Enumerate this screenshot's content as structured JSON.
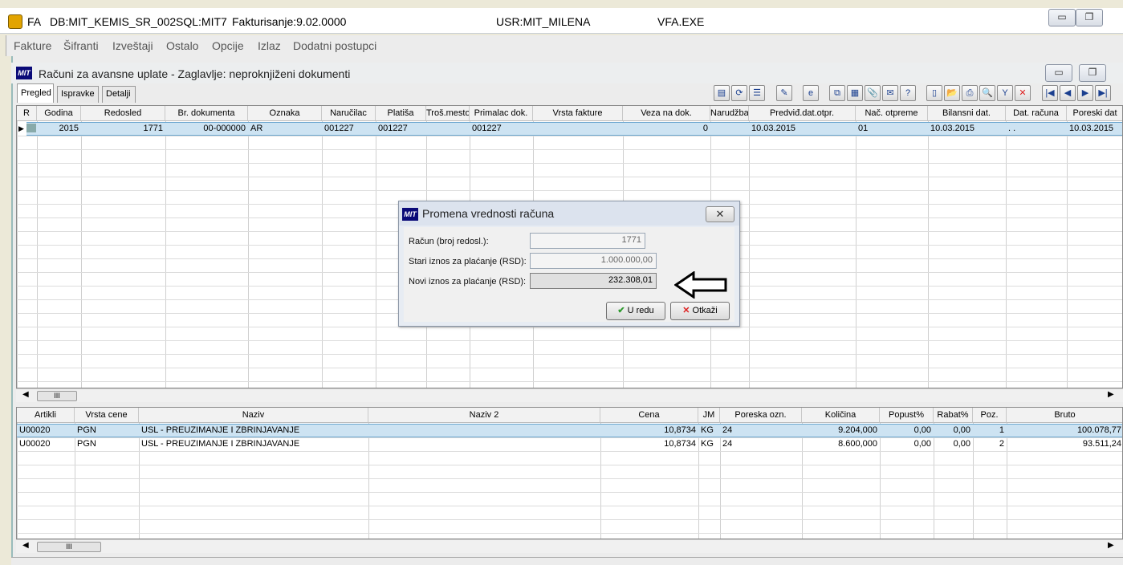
{
  "titlebar": {
    "app": "FA",
    "db": "DB:MIT_KEMIS_SR_002",
    "sql": "SQL:MIT7",
    "version": "Fakturisanje:9.02.0000",
    "user": "USR:MIT_MILENA",
    "exe": "VFA.EXE",
    "minimize": "▭",
    "restore": "❐"
  },
  "menu": [
    "Fakture",
    "Šifranti",
    "Izveštaji",
    "Ostalo",
    "Opcije",
    "Izlaz",
    "Dodatni postupci"
  ],
  "child": {
    "logo": "MIT",
    "title": "Računi za avansne uplate - Zaglavlje: neproknjiženi dokumenti",
    "tabs": [
      "Pregled",
      "Ispravke",
      "Detalji"
    ]
  },
  "toolbar_icons": [
    "form-icon",
    "refresh-icon",
    "list-icon",
    "stamp-icon",
    "ie-icon",
    "copy-icon",
    "calc-icon",
    "attach-icon",
    "chat-icon",
    "help-icon",
    "blank-icon",
    "folder-icon",
    "print-icon",
    "find-icon",
    "filter-icon",
    "cancel-icon",
    "first-icon",
    "prev-icon",
    "next-icon",
    "last-icon"
  ],
  "toolbar_glyphs": [
    "▤",
    "⟳",
    "☰",
    "✎",
    "e",
    "⧉",
    "▦",
    "📎",
    "✉",
    "?",
    "▯",
    "📂",
    "⎙",
    "🔍",
    "Y",
    "✕",
    "|◀",
    "◀",
    "▶",
    "▶|"
  ],
  "top_grid": {
    "columns": [
      "R",
      "Godina",
      "Redosled",
      "Br. dokumenta",
      "Oznaka",
      "Naručilac",
      "Platiša",
      "Troš.mesto",
      "Primalac dok.",
      "Vrsta fakture",
      "Veza na dok.",
      "Narudžba",
      "Predviđ.dat.otpr.",
      "Nač. otpreme",
      "Bilansni dat.",
      "Dat. računa",
      "Poreski dat"
    ],
    "row": [
      "",
      "2015",
      "1771",
      "00-000000",
      "AR",
      "001227",
      "001227",
      "",
      "001227",
      "",
      "0",
      "",
      "10.03.2015",
      "01",
      "10.03.2015",
      ". .",
      "10.03.2015"
    ]
  },
  "bottom_grid": {
    "columns": [
      "Artikli",
      "Vrsta cene",
      "Naziv",
      "Naziv 2",
      "Cena",
      "JM",
      "Poreska ozn.",
      "Količina",
      "Popust%",
      "Rabat%",
      "Poz.",
      "Bruto"
    ],
    "rows": [
      [
        "U00020",
        "PGN",
        "USL - PREUZIMANJE I ZBRINJAVANJE",
        "",
        "10,8734",
        "KG",
        "24",
        "9.204,000",
        "0,00",
        "0,00",
        "1",
        "100.078,77"
      ],
      [
        "U00020",
        "PGN",
        "USL - PREUZIMANJE I ZBRINJAVANJE",
        "",
        "10,8734",
        "KG",
        "24",
        "8.600,000",
        "0,00",
        "0,00",
        "2",
        "93.511,24"
      ]
    ]
  },
  "scroll_thumb": "III",
  "dialog": {
    "logo": "MIT",
    "title": "Promena vrednosti računa",
    "close": "✕",
    "fields": [
      {
        "label": "Račun (broj redosl.):",
        "value": "1771"
      },
      {
        "label": "Stari iznos za plaćanje (RSD):",
        "value": "1.000.000,00"
      },
      {
        "label": "Novi iznos za plaćanje (RSD):",
        "value": "232.308,01"
      }
    ],
    "ok_icon": "✔",
    "ok_label": "U redu",
    "cancel_icon": "✕",
    "cancel_label": "Otkaži"
  }
}
